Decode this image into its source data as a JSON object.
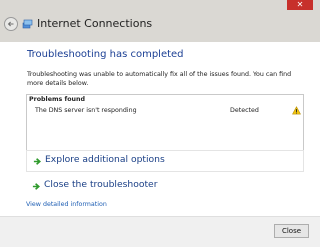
{
  "window": {
    "title": "Internet Connections",
    "close_glyph": "✕"
  },
  "main": {
    "heading": "Troubleshooting has completed",
    "description": "Troubleshooting was unable to automatically fix all of the issues found. You can find more details below.",
    "problems_header": "Problems found",
    "problems": [
      {
        "name": "The DNS server isn't responding",
        "status": "Detected",
        "icon": "warning-icon"
      }
    ],
    "explore_label": "Explore additional options",
    "close_troubleshooter_label": "Close the troubleshooter",
    "detail_link": "View detailed information"
  },
  "footer": {
    "close_button": "Close"
  },
  "colors": {
    "heading": "#1b3f94",
    "link": "#1f5fb4",
    "arrow": "#2f9a2c",
    "warning": "#f1c40f",
    "close_button_red": "#c7302b"
  },
  "icons": {
    "back": "back-arrow-icon",
    "app": "network-icon",
    "arrow": "green-arrow-icon",
    "warning": "warning-icon"
  }
}
